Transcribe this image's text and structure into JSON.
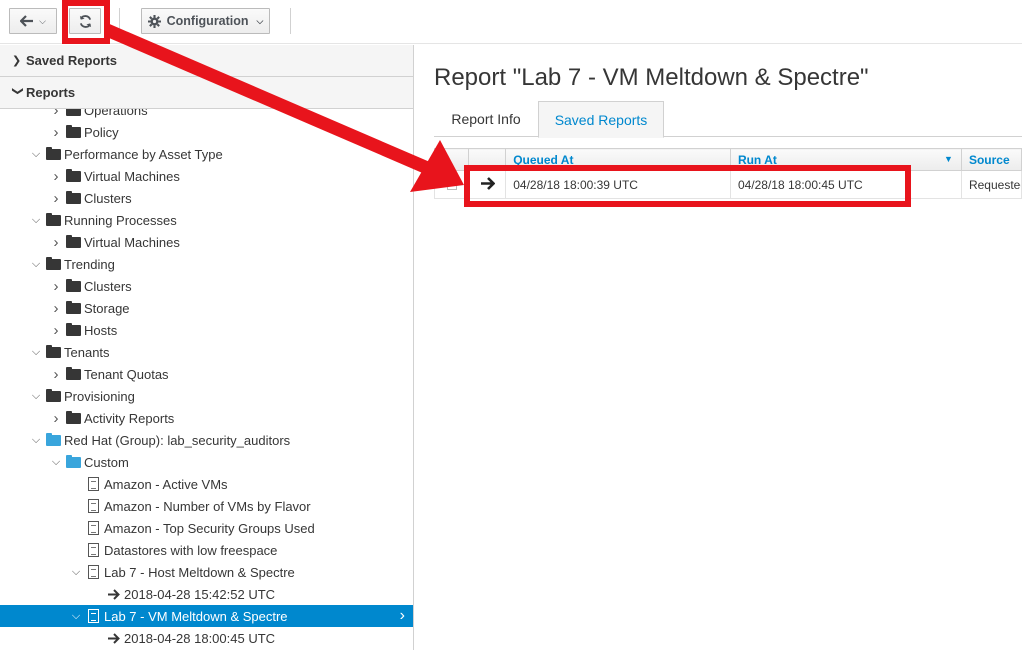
{
  "toolbar": {
    "back_icon": "arrow-left-icon",
    "refresh_icon": "refresh-icon",
    "config_label": "Configuration",
    "config_icon": "gear-icon"
  },
  "accordion": {
    "saved_reports": "Saved Reports",
    "reports": "Reports"
  },
  "tree": [
    {
      "label": "Operations",
      "depth": 2,
      "icon": "folder",
      "toggle": "collapsed"
    },
    {
      "label": "Policy",
      "depth": 2,
      "icon": "folder",
      "toggle": "collapsed"
    },
    {
      "label": "Performance by Asset Type",
      "depth": 1,
      "icon": "folder",
      "toggle": "expanded"
    },
    {
      "label": "Virtual Machines",
      "depth": 2,
      "icon": "folder",
      "toggle": "collapsed"
    },
    {
      "label": "Clusters",
      "depth": 2,
      "icon": "folder",
      "toggle": "collapsed"
    },
    {
      "label": "Running Processes",
      "depth": 1,
      "icon": "folder",
      "toggle": "expanded"
    },
    {
      "label": "Virtual Machines",
      "depth": 2,
      "icon": "folder",
      "toggle": "collapsed"
    },
    {
      "label": "Trending",
      "depth": 1,
      "icon": "folder",
      "toggle": "expanded"
    },
    {
      "label": "Clusters",
      "depth": 2,
      "icon": "folder",
      "toggle": "collapsed"
    },
    {
      "label": "Storage",
      "depth": 2,
      "icon": "folder",
      "toggle": "collapsed"
    },
    {
      "label": "Hosts",
      "depth": 2,
      "icon": "folder",
      "toggle": "collapsed"
    },
    {
      "label": "Tenants",
      "depth": 1,
      "icon": "folder",
      "toggle": "expanded"
    },
    {
      "label": "Tenant Quotas",
      "depth": 2,
      "icon": "folder",
      "toggle": "collapsed"
    },
    {
      "label": "Provisioning",
      "depth": 1,
      "icon": "folder",
      "toggle": "expanded"
    },
    {
      "label": "Activity Reports",
      "depth": 2,
      "icon": "folder",
      "toggle": "collapsed"
    },
    {
      "label": "Red Hat (Group): lab_security_auditors",
      "depth": 1,
      "icon": "folder-blue",
      "toggle": "expanded"
    },
    {
      "label": "Custom",
      "depth": 2,
      "icon": "folder-blue",
      "toggle": "expanded"
    },
    {
      "label": "Amazon - Active VMs",
      "depth": 3,
      "icon": "doc",
      "toggle": "none"
    },
    {
      "label": "Amazon - Number of VMs by Flavor",
      "depth": 3,
      "icon": "doc",
      "toggle": "none"
    },
    {
      "label": "Amazon - Top Security Groups Used",
      "depth": 3,
      "icon": "doc",
      "toggle": "none"
    },
    {
      "label": "Datastores with low freespace",
      "depth": 3,
      "icon": "doc",
      "toggle": "none"
    },
    {
      "label": "Lab 7 - Host Meltdown & Spectre",
      "depth": 3,
      "icon": "doc",
      "toggle": "expanded"
    },
    {
      "label": "2018-04-28 15:42:52 UTC",
      "depth": 4,
      "icon": "arrow",
      "toggle": "none"
    },
    {
      "label": "Lab 7 - VM Meltdown & Spectre",
      "depth": 3,
      "icon": "doc",
      "toggle": "expanded",
      "selected": true
    },
    {
      "label": "2018-04-28 18:00:45 UTC",
      "depth": 4,
      "icon": "arrow",
      "toggle": "none"
    }
  ],
  "main": {
    "title": "Report \"Lab 7 - VM Meltdown & Spectre\"",
    "tabs": [
      "Report Info",
      "Saved Reports"
    ],
    "active_tab": "Saved Reports",
    "table": {
      "columns": [
        "",
        "",
        "Queued At",
        "Run At",
        "Source"
      ],
      "rows": [
        {
          "queued_at": "04/28/18 18:00:39 UTC",
          "run_at": "04/28/18 18:00:45 UTC",
          "source": "Requested by user"
        }
      ]
    }
  },
  "annotations": {
    "highlight_color": "#e8141c"
  }
}
